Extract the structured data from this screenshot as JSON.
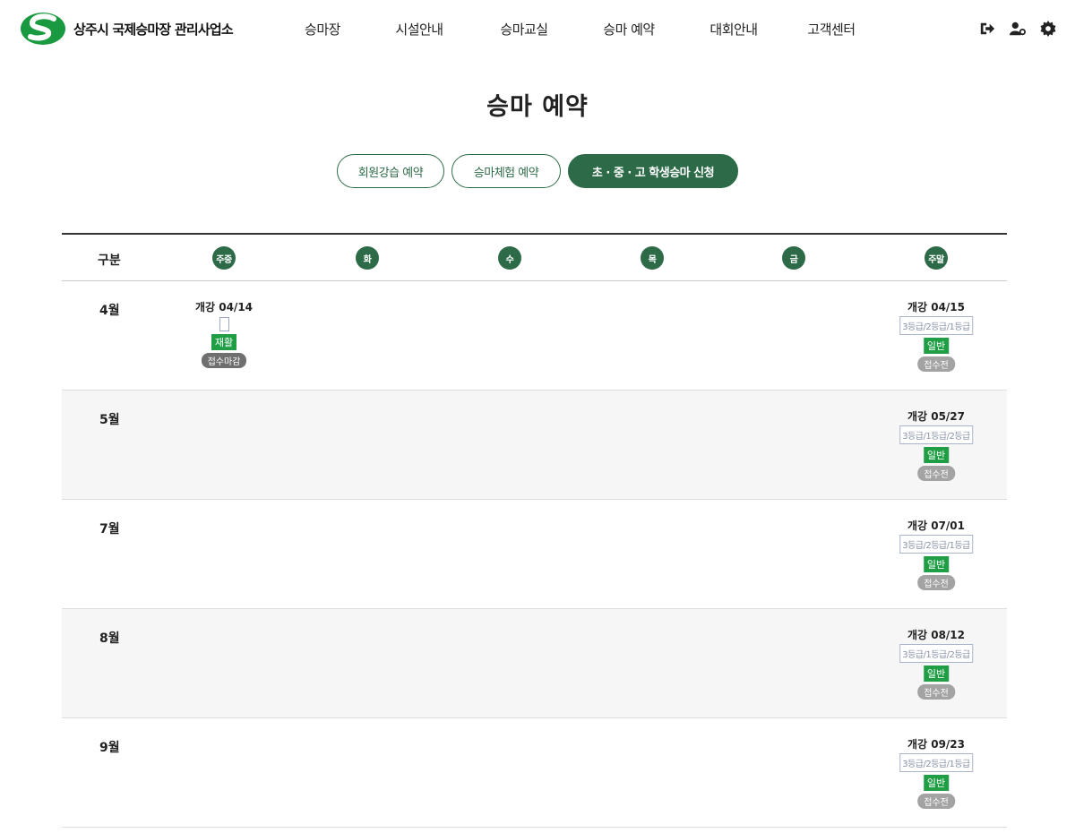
{
  "site": {
    "logo_text": "상주시 국제승마장 관리사업소",
    "logo_icon": "S-logo"
  },
  "nav": [
    "승마장",
    "시설안내",
    "승마교실",
    "승마 예약",
    "대회안내",
    "고객센터"
  ],
  "util_icons": [
    "logout-icon",
    "user-settings-icon",
    "gear-icon"
  ],
  "page_title": "승마 예약",
  "tabs": [
    {
      "label": "회원강습 예약",
      "active": false
    },
    {
      "label": "승마체험 예약",
      "active": false
    },
    {
      "label": "초 · 중 · 고 학생승마 신청",
      "active": true
    }
  ],
  "table": {
    "corner_label": "구분",
    "days": [
      "주중",
      "화",
      "수",
      "목",
      "금",
      "주말"
    ],
    "rows": [
      {
        "month": "4월",
        "weekday": {
          "open": "개강 04/14",
          "type": "재활",
          "status": "접수마감"
        },
        "weekend": {
          "open": "개강 04/15",
          "grade": "3등급/2등급/1등급",
          "type": "일반",
          "status": "접수전"
        }
      },
      {
        "month": "5월",
        "weekend": {
          "open": "개강 05/27",
          "grade": "3등급/1등급/2등급",
          "type": "일반",
          "status": "접수전"
        }
      },
      {
        "month": "7월",
        "weekend": {
          "open": "개강 07/01",
          "grade": "3등급/2등급/1등급",
          "type": "일반",
          "status": "접수전"
        }
      },
      {
        "month": "8월",
        "weekend": {
          "open": "개강 08/12",
          "grade": "3등급/1등급/2등급",
          "type": "일반",
          "status": "접수전"
        }
      },
      {
        "month": "9월",
        "weekend": {
          "open": "개강 09/23",
          "grade": "3등급/2등급/1등급",
          "type": "일반",
          "status": "접수전"
        }
      }
    ]
  },
  "colors": {
    "brand_green": "#2d6b48",
    "badge_green": "#1f9e45",
    "status_gray": "#a3a3a3",
    "closed_gray": "#6f6f6f"
  }
}
